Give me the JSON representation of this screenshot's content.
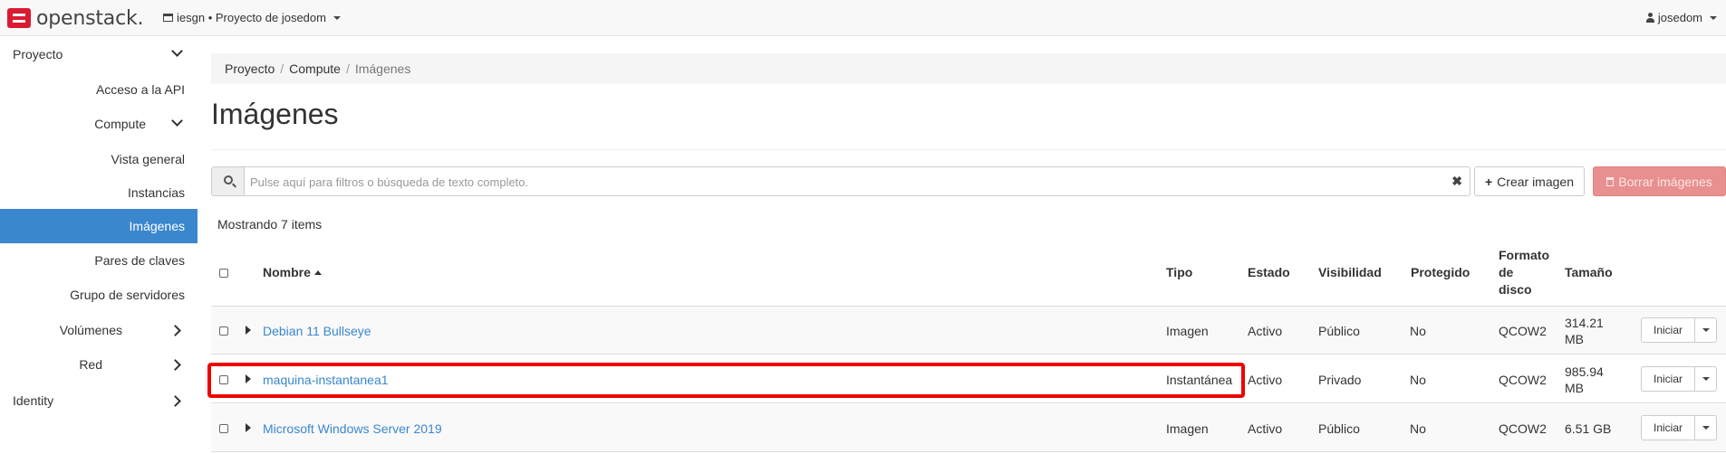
{
  "topbar": {
    "brand": "openstack.",
    "project": "iesgn • Proyecto de josedom",
    "user": "josedom"
  },
  "sidebar": {
    "items": [
      {
        "label": "Proyecto",
        "chevron": "down"
      },
      {
        "label": "Acceso a la API"
      },
      {
        "label": "Compute",
        "chevron": "down"
      },
      {
        "label": "Vista general"
      },
      {
        "label": "Instancias"
      },
      {
        "label": "Imágenes",
        "active": true
      },
      {
        "label": "Pares de claves"
      },
      {
        "label": "Grupo de servidores"
      },
      {
        "label": "Volúmenes",
        "chevron": "right"
      },
      {
        "label": "Red",
        "chevron": "right"
      },
      {
        "label": "Identity",
        "chevron": "right"
      }
    ]
  },
  "breadcrumb": [
    "Proyecto",
    "Compute",
    "Imágenes"
  ],
  "page_title": "Imágenes",
  "toolbar": {
    "filter_placeholder": "Pulse aquí para filtros o búsqueda de texto completo.",
    "clear_label": "✖",
    "create_label": "Crear imagen",
    "delete_label": "Borrar imágenes"
  },
  "showing": "Mostrando 7 items",
  "table": {
    "headers": {
      "name": "Nombre",
      "type": "Tipo",
      "status": "Estado",
      "visibility": "Visibilidad",
      "protected": "Protegido",
      "format_line1": "Formato",
      "format_line2": "de",
      "format_line3": "disco",
      "size": "Tamaño"
    },
    "rows": [
      {
        "name": "Debian 11 Bullseye",
        "type": "Imagen",
        "status": "Activo",
        "visibility": "Público",
        "protected": "No",
        "format": "QCOW2",
        "size_line1": "314.21",
        "size_line2": "MB",
        "action": "Iniciar"
      },
      {
        "name": "maquina-instantanea1",
        "type": "Instantánea",
        "status": "Activo",
        "visibility": "Privado",
        "protected": "No",
        "format": "QCOW2",
        "size_line1": "985.94",
        "size_line2": "MB",
        "action": "Iniciar"
      },
      {
        "name": "Microsoft Windows Server 2019",
        "type": "Imagen",
        "status": "Activo",
        "visibility": "Público",
        "protected": "No",
        "format": "QCOW2",
        "size_line1": "6.51 GB",
        "size_line2": "",
        "action": "Iniciar"
      }
    ]
  },
  "colors": {
    "accent": "#3a87ce",
    "danger": "#e8908f",
    "highlight": "#ee0000"
  }
}
